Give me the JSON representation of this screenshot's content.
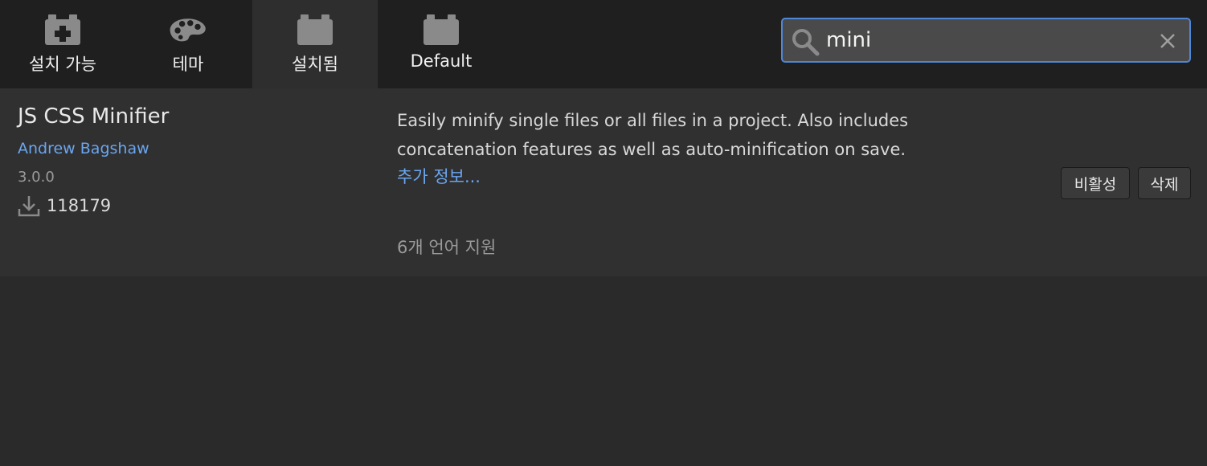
{
  "tabs": [
    {
      "label": "설치 가능",
      "icon": "plus-box-icon"
    },
    {
      "label": "테마",
      "icon": "palette-icon"
    },
    {
      "label": "설치됨",
      "icon": "box-icon",
      "active": true
    },
    {
      "label": "Default",
      "icon": "box-icon"
    }
  ],
  "search": {
    "value": "mini",
    "placeholder": ""
  },
  "extension": {
    "name": "JS CSS Minifier",
    "author": "Andrew Bagshaw",
    "version": "3.0.0",
    "downloads": "118179",
    "description": "Easily minify single files or all files in a project. Also includes concatenation features as well as auto-minification on save.",
    "more_info": "추가 정보...",
    "languages": "6개 언어 지원",
    "disable_label": "비활성",
    "remove_label": "삭제"
  },
  "colors": {
    "accent": "#4f86d6",
    "link": "#6aa6f0",
    "toolbar_bg": "#1f1f1f",
    "panel_bg": "#303030"
  }
}
